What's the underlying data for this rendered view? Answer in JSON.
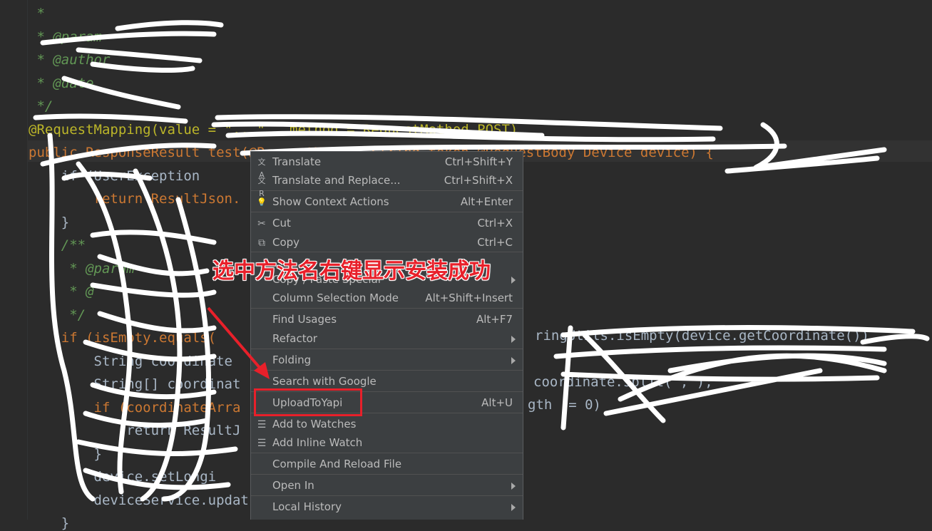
{
  "editor": {
    "lines": [
      {
        "cls": "c-doc",
        "text": " *"
      },
      {
        "cls": "c-doc",
        "text": " * @param"
      },
      {
        "cls": "c-doc",
        "text": " * @author"
      },
      {
        "cls": "c-doc",
        "text": " * @date"
      },
      {
        "cls": "c-doc",
        "text": " */"
      },
      {
        "cls": "c-ann",
        "text": "@RequestMapping(value = \"...\" , method = RequestMethod.POST)"
      },
      {
        "cls": "c-kw",
        "text": "public ResponseResult test(@RequestHeader String token,@RequestBody Device device) {"
      },
      {
        "cls": "c-plain",
        "text": "    if (UserException"
      },
      {
        "cls": "c-kw",
        "text": "        return ResultJson."
      },
      {
        "cls": "c-plain",
        "text": "    }"
      },
      {
        "cls": "c-doc",
        "text": "    /**"
      },
      {
        "cls": "c-doc",
        "text": "     * @param"
      },
      {
        "cls": "c-doc",
        "text": "     * @"
      },
      {
        "cls": "c-doc",
        "text": "     */"
      },
      {
        "cls": "c-kw",
        "text": "    if (isEmpty.equals("
      },
      {
        "cls": "c-plain",
        "text": "        String coordinate"
      },
      {
        "cls": "c-plain",
        "text": "        String[] coordinat"
      },
      {
        "cls": "c-kw",
        "text": "        if (coordinateArra"
      },
      {
        "cls": "c-plain",
        "text": "            return ResultJ"
      },
      {
        "cls": "c-plain",
        "text": "        }"
      },
      {
        "cls": "c-plain",
        "text": "        device.setLongi"
      },
      {
        "cls": "c-plain",
        "text": "        deviceService.updat"
      },
      {
        "cls": "c-plain",
        "text": "    }"
      }
    ],
    "right_fragments": [
      {
        "text": "ringUtils.isEmpty(device.getCoordinate())",
        "cls": "c-plain"
      },
      {
        "text": "coordinate.split(\",\");",
        "cls": "c-plain"
      },
      {
        "text": "gth != 0)",
        "cls": "c-plain"
      }
    ]
  },
  "menu": {
    "items": [
      {
        "icon": "translate-icon",
        "glyph": "文A",
        "label": "Translate",
        "shortcut": "Ctrl+Shift+Y",
        "sub": false
      },
      {
        "icon": "translate-replace-icon",
        "glyph": "文R",
        "label": "Translate and Replace...",
        "shortcut": "Ctrl+Shift+X",
        "sub": false
      },
      {
        "icon": "lightbulb-icon",
        "glyph": "💡",
        "label": "Show Context Actions",
        "shortcut": "Alt+Enter",
        "sub": false
      },
      {
        "icon": "scissors-icon",
        "glyph": "✂",
        "label": "Cut",
        "shortcut": "Ctrl+X",
        "sub": false
      },
      {
        "icon": "copy-icon",
        "glyph": "⧉",
        "label": "Copy",
        "shortcut": "Ctrl+C",
        "sub": false
      },
      {
        "icon": "",
        "glyph": "",
        "label": "Copy / Paste Special",
        "shortcut": "",
        "sub": true
      },
      {
        "icon": "",
        "glyph": "",
        "label": "Column Selection Mode",
        "shortcut": "Alt+Shift+Insert",
        "sub": false
      },
      {
        "icon": "",
        "glyph": "",
        "label": "Find Usages",
        "shortcut": "Alt+F7",
        "sub": false
      },
      {
        "icon": "",
        "glyph": "",
        "label": "Refactor",
        "shortcut": "",
        "sub": true
      },
      {
        "icon": "",
        "glyph": "",
        "label": "Folding",
        "shortcut": "",
        "sub": true
      },
      {
        "icon": "",
        "glyph": "",
        "label": "Search with Google",
        "shortcut": "",
        "sub": false
      },
      {
        "icon": "",
        "glyph": "",
        "label": "UploadToYapi",
        "shortcut": "Alt+U",
        "sub": false
      },
      {
        "icon": "watch-icon",
        "glyph": "☰",
        "label": "Add to Watches",
        "shortcut": "",
        "sub": false
      },
      {
        "icon": "inline-watch-icon",
        "glyph": "☰",
        "label": "Add Inline Watch",
        "shortcut": "",
        "sub": false
      },
      {
        "icon": "",
        "glyph": "",
        "label": "Compile And Reload File",
        "shortcut": "",
        "sub": false
      },
      {
        "icon": "",
        "glyph": "",
        "label": "Open In",
        "shortcut": "",
        "sub": true
      },
      {
        "icon": "",
        "glyph": "",
        "label": "Local History",
        "shortcut": "",
        "sub": true
      }
    ]
  },
  "annotation": {
    "text": "选中方法名右键显示安装成功",
    "color": "#e8202a"
  }
}
